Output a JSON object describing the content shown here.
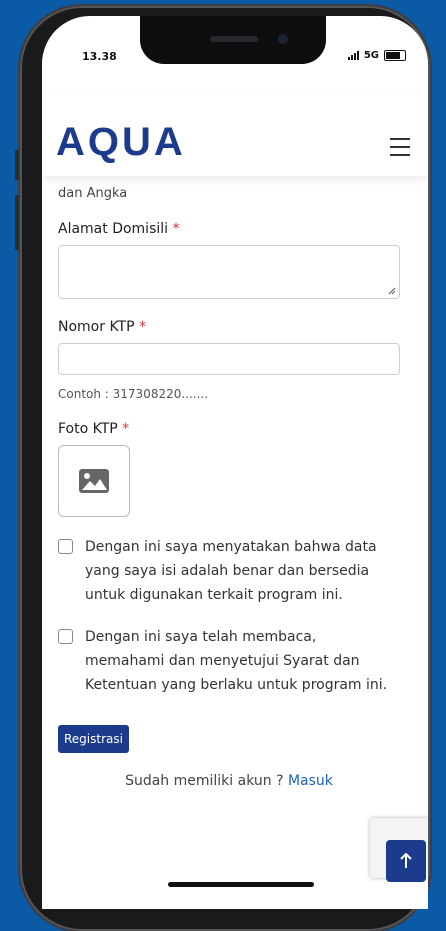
{
  "status": {
    "time": "13.38",
    "network": "5G"
  },
  "header": {
    "logo": "AQUA"
  },
  "form": {
    "prev_hint": "dan Angka",
    "domicile_label": "Alamat Domisili",
    "ktp_label": "Nomor KTP",
    "ktp_hint": "Contoh : 317308220.......",
    "photo_label": "Foto KTP",
    "required_mark": "*",
    "consent1": "Dengan ini saya menyatakan bahwa data yang saya isi adalah benar dan bersedia untuk digunakan terkait program ini.",
    "consent2": "Dengan ini saya telah membaca, memahami dan menyetujui Syarat dan Ketentuan yang berlaku untuk program ini.",
    "register_button": "Registrasi",
    "login_prompt": "Sudah memiliki akun ?",
    "login_link": "Masuk"
  },
  "colors": {
    "brand": "#1d3b8c",
    "background": "#0b5aa6",
    "link": "#1d63b8"
  }
}
